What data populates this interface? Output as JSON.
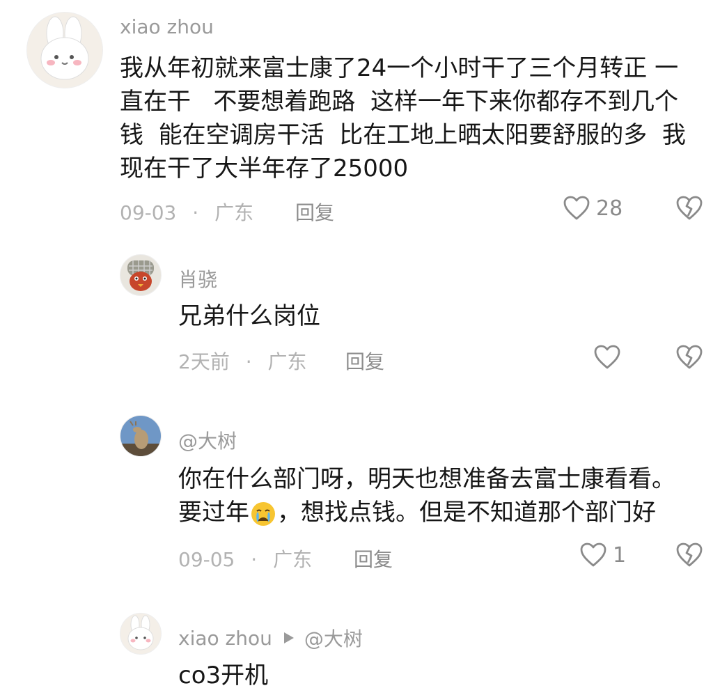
{
  "comments": [
    {
      "username": "xiao zhou",
      "lines": [
        "我从年初就来富士康了24一个小时干了三个月转正 一",
        "直在干   不要想着跑路  这样一年下来你都存不到几个",
        "钱  能在空调房干活  比在工地上晒太阳要舒服的多  我",
        "现在干了大半年存了25000"
      ],
      "date": "09-03",
      "location": "广东",
      "reply_label": "回复",
      "likes": "28"
    },
    {
      "username": "肖骁",
      "lines": [
        "兄弟什么岗位"
      ],
      "date": "2天前",
      "location": "广东",
      "reply_label": "回复",
      "likes": ""
    },
    {
      "username": "@大树",
      "line1": "你在什么部门呀，明天也想准备去富士康看看。",
      "line2_before_emoji": "要过年",
      "line2_after_emoji": "，想找点钱。但是不知道那个部门好",
      "date": "09-05",
      "location": "广东",
      "reply_label": "回复",
      "likes": "1"
    },
    {
      "username": "xiao zhou",
      "reply_to": "@大树",
      "lines": [
        "co3开机"
      ]
    }
  ],
  "separator": "·",
  "icons": {
    "like": "heart-outline-icon",
    "dislike": "broken-heart-icon",
    "reply_arrow": "play-arrow-icon",
    "emoji": "crying-face-emoji"
  }
}
